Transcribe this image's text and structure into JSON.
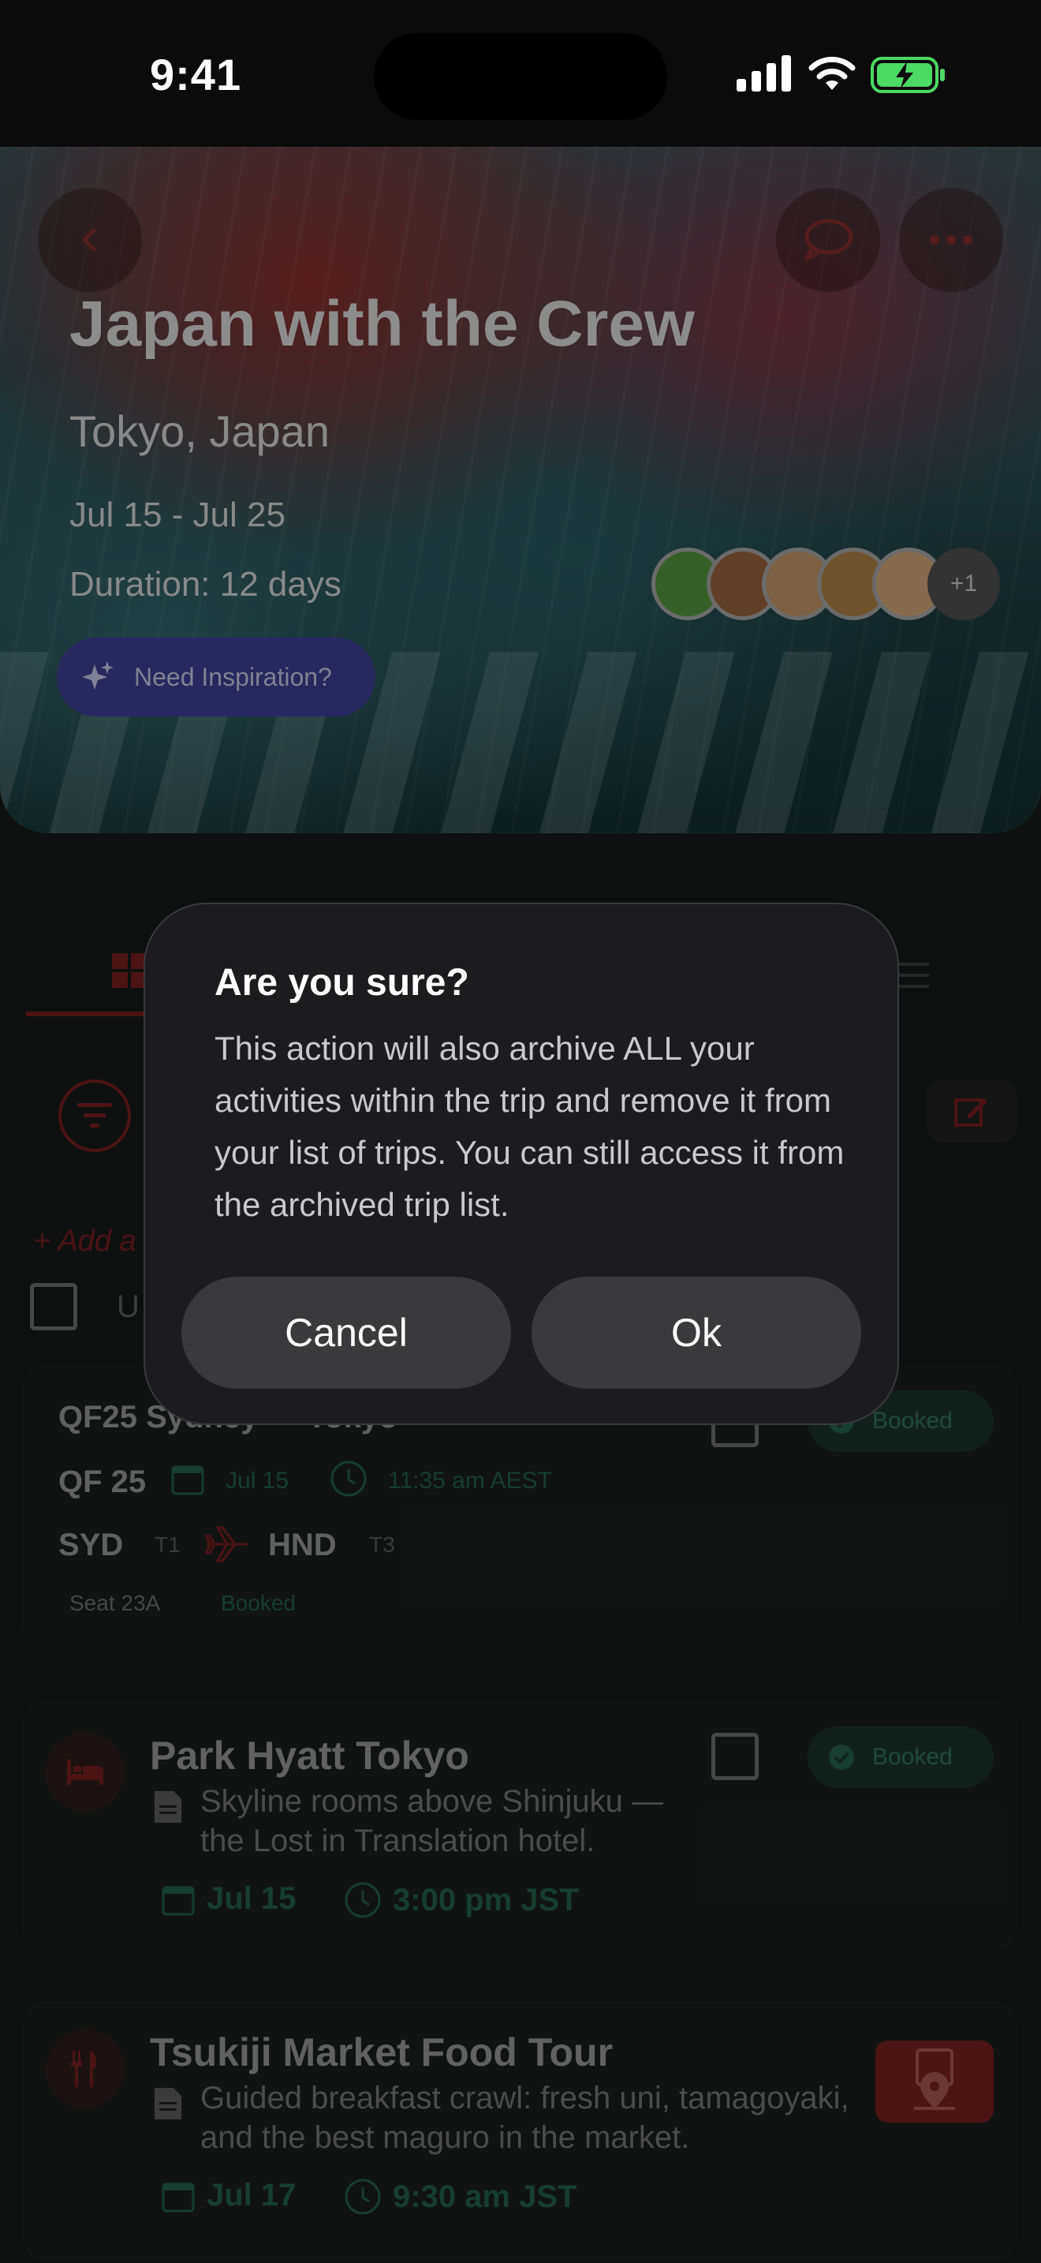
{
  "status_bar": {
    "time": "9:41"
  },
  "hero": {
    "title": "Japan with the Crew",
    "location": "Tokyo, Japan",
    "dates": "Jul 15 - Jul 25",
    "duration": "Duration: 12 days",
    "inspiration_label": "Need Inspiration?",
    "avatars_more": "+1"
  },
  "list": {
    "add_link": "+ Add a",
    "row_label": "U"
  },
  "flight_card": {
    "title": "QF25 Sydney — Tokyo",
    "flight_no": "QF 25",
    "date": "Jul 15",
    "time": "11:35 am AEST",
    "from": "SYD",
    "from_terminal": "T1",
    "to": "HND",
    "to_terminal": "T3",
    "seat": "Seat 23A",
    "status": "Booked",
    "badge": "Booked"
  },
  "hotel_card": {
    "title": "Park Hyatt Tokyo",
    "desc_line1": "Skyline rooms above Shinjuku —",
    "desc_line2": "the Lost in Translation hotel.",
    "date": "Jul 15",
    "time": "3:00 pm JST",
    "badge": "Booked"
  },
  "food_card": {
    "title": "Tsukiji Market Food Tour",
    "desc_line1": "Guided breakfast crawl: fresh uni, tamagoyaki,",
    "desc_line2": "and the best maguro in the market.",
    "date": "Jul 17",
    "time": "9:30 am JST"
  },
  "dialog": {
    "title": "Are you sure?",
    "body": "This action will also archive ALL your activities within the trip and remove it from your list of trips. You can still access it from the archived trip list.",
    "cancel_label": "Cancel",
    "ok_label": "Ok"
  },
  "colors": {
    "accent_red": "#6e1e1e",
    "booked_green": "#215a45",
    "dialog_bg": "#1c1c1e",
    "dialog_button": "#3a3a3c",
    "inspiration_purple": "#3a3a8a"
  }
}
